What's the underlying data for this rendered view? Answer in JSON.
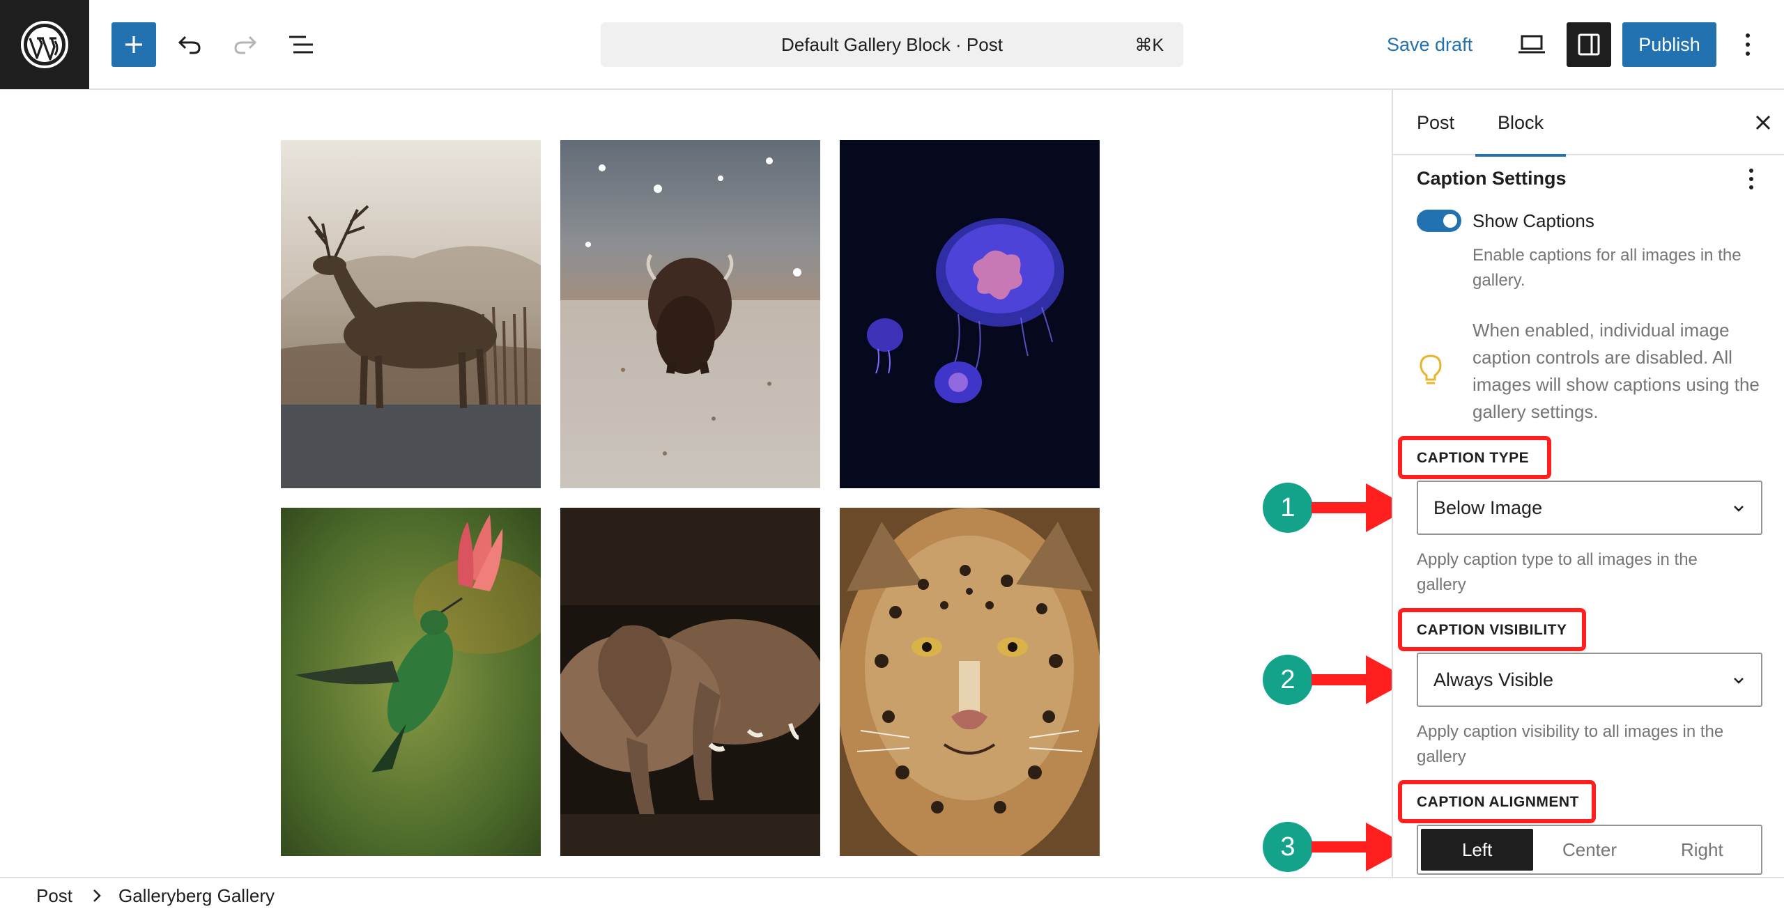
{
  "header": {
    "document_title": "Default Gallery Block · Post",
    "shortcut": "⌘K",
    "save_draft": "Save draft",
    "publish": "Publish"
  },
  "sidebar": {
    "tabs": [
      {
        "label": "Post"
      },
      {
        "label": "Block"
      }
    ],
    "panel_title": "Caption Settings",
    "toggle_label": "Show Captions",
    "toggle_help": "Enable captions for all images in the gallery.",
    "notice": "When enabled, individual image caption controls are disabled. All images will show captions using the gallery settings.",
    "caption_type": {
      "label": "CAPTION TYPE",
      "value": "Below Image",
      "help": "Apply caption type to all images in the gallery"
    },
    "caption_visibility": {
      "label": "CAPTION VISIBILITY",
      "value": "Always Visible",
      "help": "Apply caption visibility to all images in the gallery"
    },
    "caption_alignment": {
      "label": "CAPTION ALIGNMENT",
      "options": [
        "Left",
        "Center",
        "Right"
      ],
      "selected": "Left"
    }
  },
  "annotations": [
    "1",
    "2",
    "3"
  ],
  "gallery": {
    "images": [
      {
        "subject": "deer"
      },
      {
        "subject": "bison"
      },
      {
        "subject": "jellyfish"
      },
      {
        "subject": "hummingbird"
      },
      {
        "subject": "elephants"
      },
      {
        "subject": "leopard"
      }
    ]
  },
  "breadcrumb": {
    "items": [
      "Post",
      "Galleryberg Gallery"
    ]
  },
  "colors": {
    "accent": "#2271b1",
    "annotation_red": "#ff1f1f",
    "annotation_badge": "#12a38a"
  }
}
